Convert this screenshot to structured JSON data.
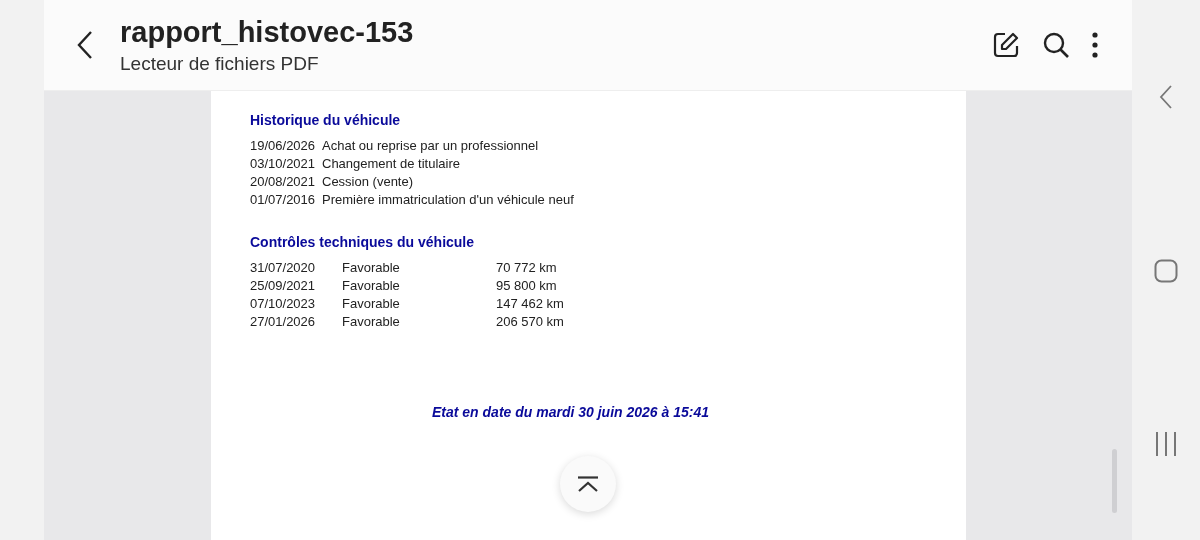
{
  "app_bar": {
    "title": "rapport_histovec-153",
    "subtitle": "Lecteur de fichiers PDF"
  },
  "document": {
    "history": {
      "heading": "Historique du véhicule",
      "rows": [
        {
          "date": "19/06/2026",
          "event": "Achat ou reprise par un professionnel"
        },
        {
          "date": "03/10/2021",
          "event": "Changement de titulaire"
        },
        {
          "date": "20/08/2021",
          "event": "Cession (vente)"
        },
        {
          "date": "01/07/2016",
          "event": "Première immatriculation d'un véhicule neuf"
        }
      ]
    },
    "inspections": {
      "heading": "Contrôles techniques du véhicule",
      "rows": [
        {
          "date": "31/07/2020",
          "result": "Favorable",
          "mileage": "70 772 km"
        },
        {
          "date": "25/09/2021",
          "result": "Favorable",
          "mileage": "95 800 km"
        },
        {
          "date": "07/10/2023",
          "result": "Favorable",
          "mileage": "147 462 km"
        },
        {
          "date": "27/01/2026",
          "result": "Favorable",
          "mileage": "206 570 km"
        }
      ]
    },
    "footer": "Etat en date du mardi 30 juin 2026 à 15:41"
  }
}
